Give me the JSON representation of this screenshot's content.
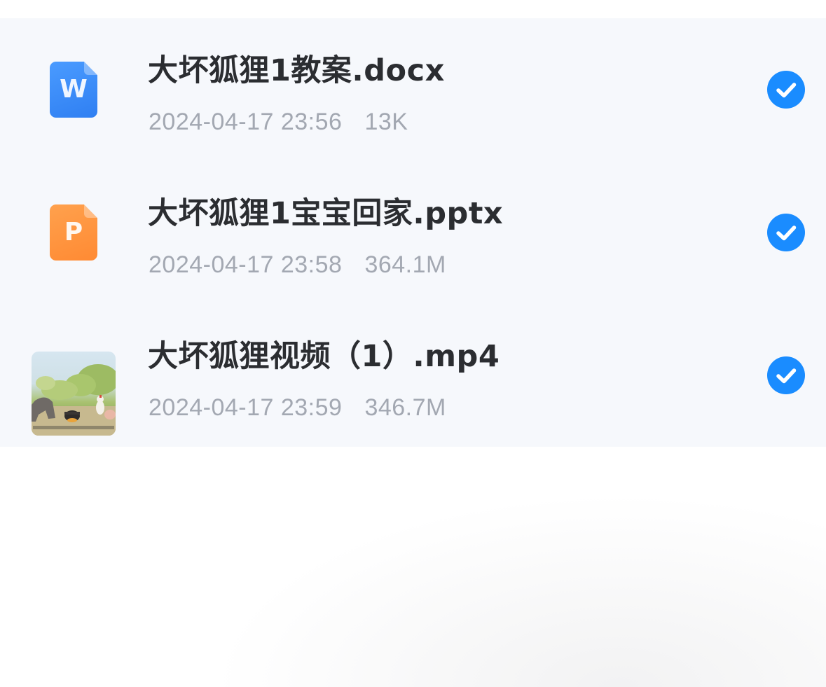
{
  "files": [
    {
      "type": "word",
      "icon": "word-doc-icon",
      "icon_letter": "W",
      "name": "大坏狐狸1教案.docx",
      "date": "2024-04-17 23:56",
      "size": "13K",
      "selected": true
    },
    {
      "type": "ppt",
      "icon": "ppt-doc-icon",
      "icon_letter": "P",
      "name": "大坏狐狸1宝宝回家.pptx",
      "date": "2024-04-17 23:58",
      "size": "364.1M",
      "selected": true
    },
    {
      "type": "video",
      "icon": "video-thumbnail",
      "name": "大坏狐狸视频（1）.mp4",
      "date": "2024-04-17 23:59",
      "size": "346.7M",
      "selected": true
    }
  ],
  "colors": {
    "accent": "#1a8cff",
    "word": "#2f7ff2",
    "ppt": "#ff8a33",
    "list_bg": "#f6f8fc",
    "title_text": "#2b2d31",
    "meta_text": "#a3a8b2"
  }
}
